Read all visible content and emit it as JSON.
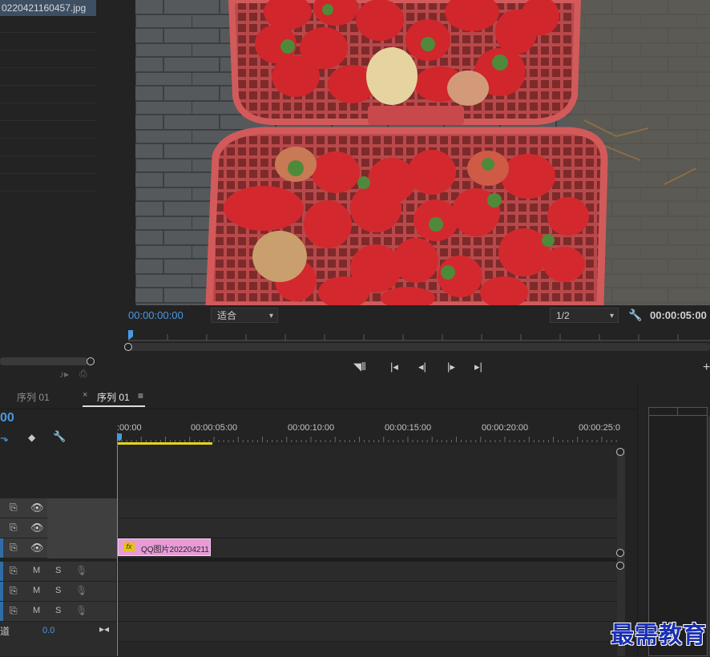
{
  "project": {
    "selected_file": "0220421160457.jpg"
  },
  "monitor": {
    "current_timecode": "00:00:00:00",
    "fit_option": "适合",
    "resolution_option": "1/2",
    "duration_timecode": "00:00:05:00",
    "image_description": "strawberries-in-red-baskets"
  },
  "timeline": {
    "tabs": [
      "序列 01",
      "序列 01"
    ],
    "close_glyph": "×",
    "menu_glyph": "≡",
    "timecode": "00",
    "ruler_labels": [
      ":00:00",
      "00:00:05:00",
      "00:00:10:00",
      "00:00:15:00",
      "00:00:20:00",
      "00:00:25:0"
    ],
    "audio_buttons": {
      "mute": "M",
      "solo": "S"
    },
    "clip_label": "QQ图片202204211",
    "clip_fx": "fx",
    "master_label": "道",
    "master_value": "0.0"
  },
  "watermark": "最需教育",
  "colors": {
    "accent_blue": "#4a98e0",
    "clip_pink": "#e79ad6",
    "work_area_yellow": "#e8d21e",
    "watermark_blue": "#1a2fb0"
  }
}
